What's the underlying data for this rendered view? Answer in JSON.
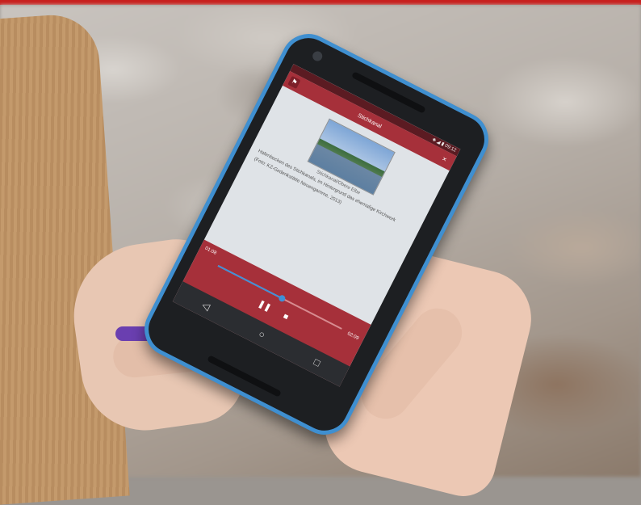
{
  "app": {
    "title": "Stichkanal",
    "status_right": "◈ ◢ ▮ 09:12",
    "close_glyph": "×",
    "logo_glyph": "⚑"
  },
  "content": {
    "caption": "Stichkanal/Obere Elbe",
    "description": "Hafenbecken des Stichkanals, im Hintergrund das ehemalige Kirchwerk",
    "credit": "(Foto: KZ-Gedenkstätte Neuengamme, 2013)"
  },
  "player": {
    "time_elapsed": "01:08",
    "time_total": "02:09",
    "progress": 0.52,
    "pause_glyph": "❚❚",
    "stop_glyph": "■"
  },
  "navbar": {
    "back_glyph": "◁",
    "home_glyph": "○",
    "recents_glyph": "□"
  },
  "colors": {
    "accent": "#a6303a",
    "phone_bumper": "#3f8fd0",
    "top_strip": "#c8201e"
  }
}
